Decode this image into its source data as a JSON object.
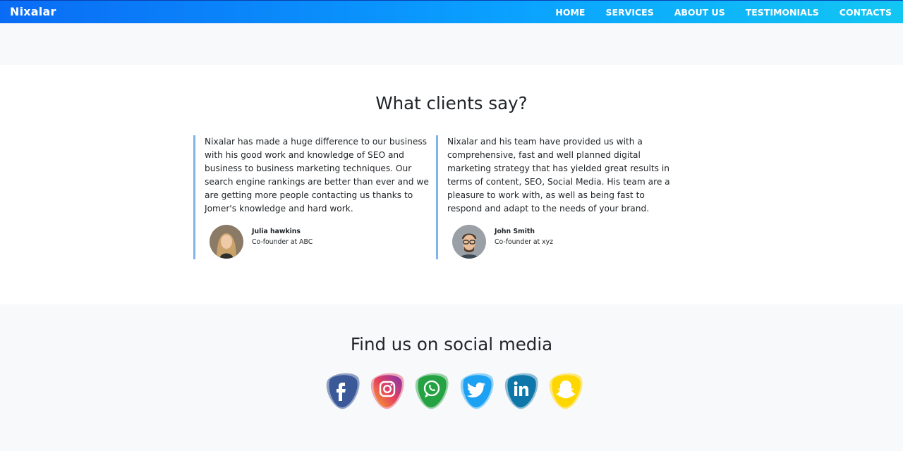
{
  "navbar": {
    "brand": "Nixalar",
    "links": [
      "HOME",
      "SERVICES",
      "ABOUT US",
      "TESTIMONIALS",
      "CONTACTS"
    ]
  },
  "testimonials": {
    "title": "What clients say?",
    "items": [
      {
        "quote": "Nixalar has made a huge difference to our business with his good work and knowledge of SEO and business to business marketing techniques. Our search engine rankings are better than ever and we are getting more people contacting us thanks to Jomer's knowledge and hard work.",
        "name": "Julia hawkins",
        "role": "Co-founder at ABC"
      },
      {
        "quote": "Nixalar and his team have provided us with a comprehensive, fast and well planned digital marketing strategy that has yielded great results in terms of content, SEO, Social Media. His team are a pleasure to work with, as well as being fast to respond and adapt to the needs of your brand.",
        "name": "John Smith",
        "role": "Co-founder at xyz"
      }
    ]
  },
  "social": {
    "title": "Find us on social media",
    "icons": [
      {
        "name": "facebook-icon",
        "color": "#3b5998"
      },
      {
        "name": "instagram-icon",
        "color": "#c13584"
      },
      {
        "name": "whatsapp-icon",
        "color": "#25a244"
      },
      {
        "name": "twitter-icon",
        "color": "#1da1f2"
      },
      {
        "name": "linkedin-icon",
        "color": "#0e76a8"
      },
      {
        "name": "snapchat-icon",
        "color": "#ffd700"
      }
    ]
  },
  "colors": {
    "nav_start": "#0a6cf5",
    "nav_end": "#12c6f3",
    "quote_border": "#7fb5ec",
    "page_bg": "#f8f9fa"
  }
}
